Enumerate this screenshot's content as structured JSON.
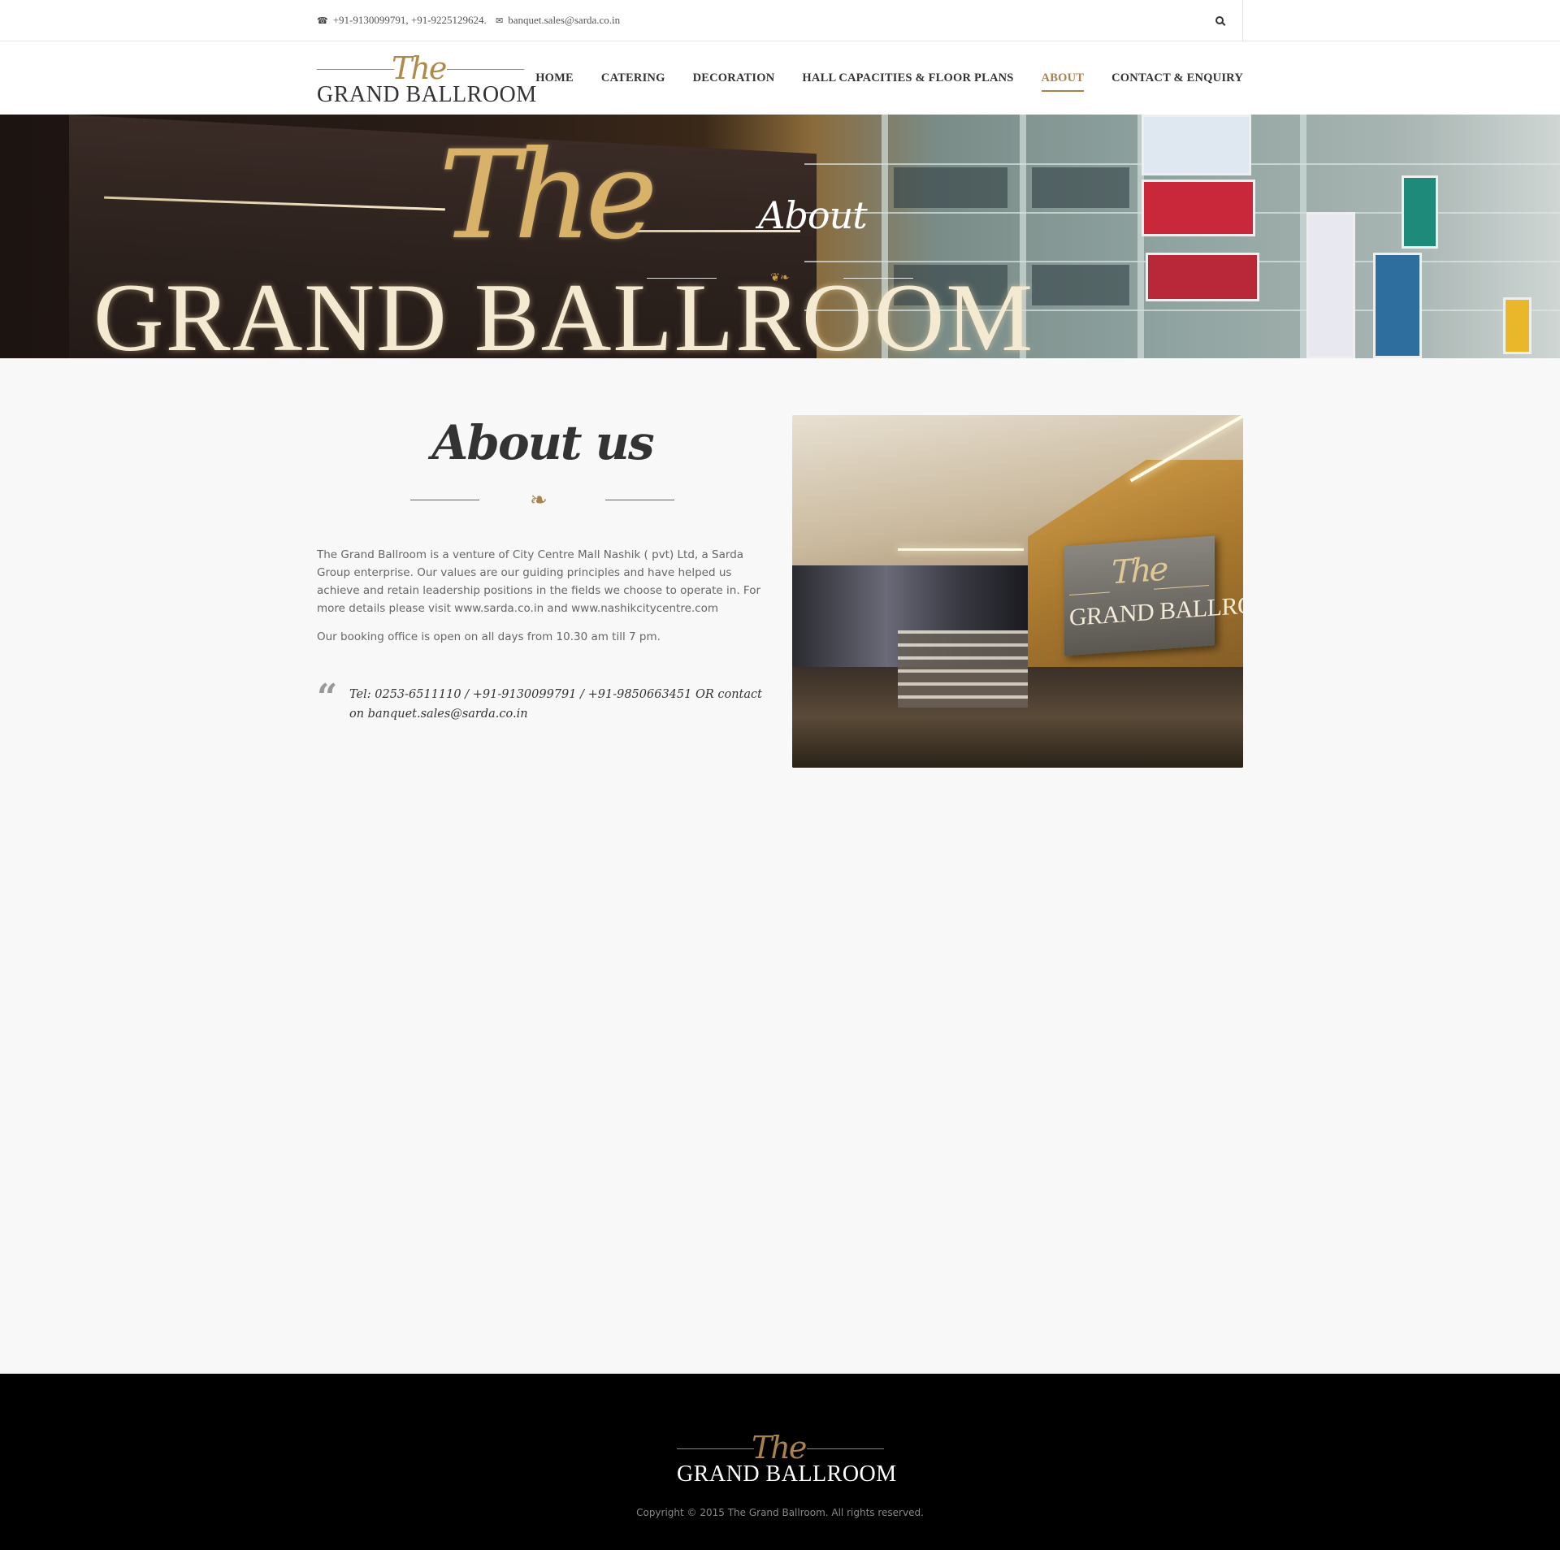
{
  "topbar": {
    "phone_icon": "phone-icon",
    "phone": "+91-9130099791, +91-9225129624.",
    "email_icon": "envelope-icon",
    "email": "banquet.sales@sarda.co.in",
    "search_icon": "search-icon"
  },
  "logo": {
    "script": "The",
    "word": "GRAND BALLROOM"
  },
  "nav": {
    "items": [
      {
        "label": "HOME"
      },
      {
        "label": "CATERING"
      },
      {
        "label": "DECORATION"
      },
      {
        "label": "HALL CAPACITIES & FLOOR PLANS"
      },
      {
        "label": "ABOUT"
      },
      {
        "label": "CONTACT & ENQUIRY"
      }
    ],
    "active": "ABOUT",
    "accent_color": "#a8824a"
  },
  "hero": {
    "title": "About",
    "sign_script": "The",
    "sign_word": "GRAND BALLROOM"
  },
  "about": {
    "heading": "About us",
    "divider_icon": "leaf-icon",
    "paragraph1": "The Grand Ballroom is a venture of City Centre Mall Nashik ( pvt) Ltd, a Sarda Group enterprise. Our values are our guiding principles and have helped us achieve and retain leadership positions in the fields we choose to operate in. For more details please visit www.sarda.co.in and www.nashikcitycentre.com",
    "paragraph2": "Our booking office is open on all days from 10.30 am till 7 pm.",
    "quote_icon": "quote-icon",
    "quote": "Tel: 0253-6511110 / +91-9130099791 / +91-9850663451 OR contact on banquet.sales@sarda.co.in",
    "photo": {
      "script": "The",
      "word": "GRAND BALLROOM"
    }
  },
  "footer": {
    "logo_script": "The",
    "logo_word": "GRAND BALLROOM",
    "copyright": "Copyright © 2015 The Grand Ballroom. All rights reserved."
  }
}
